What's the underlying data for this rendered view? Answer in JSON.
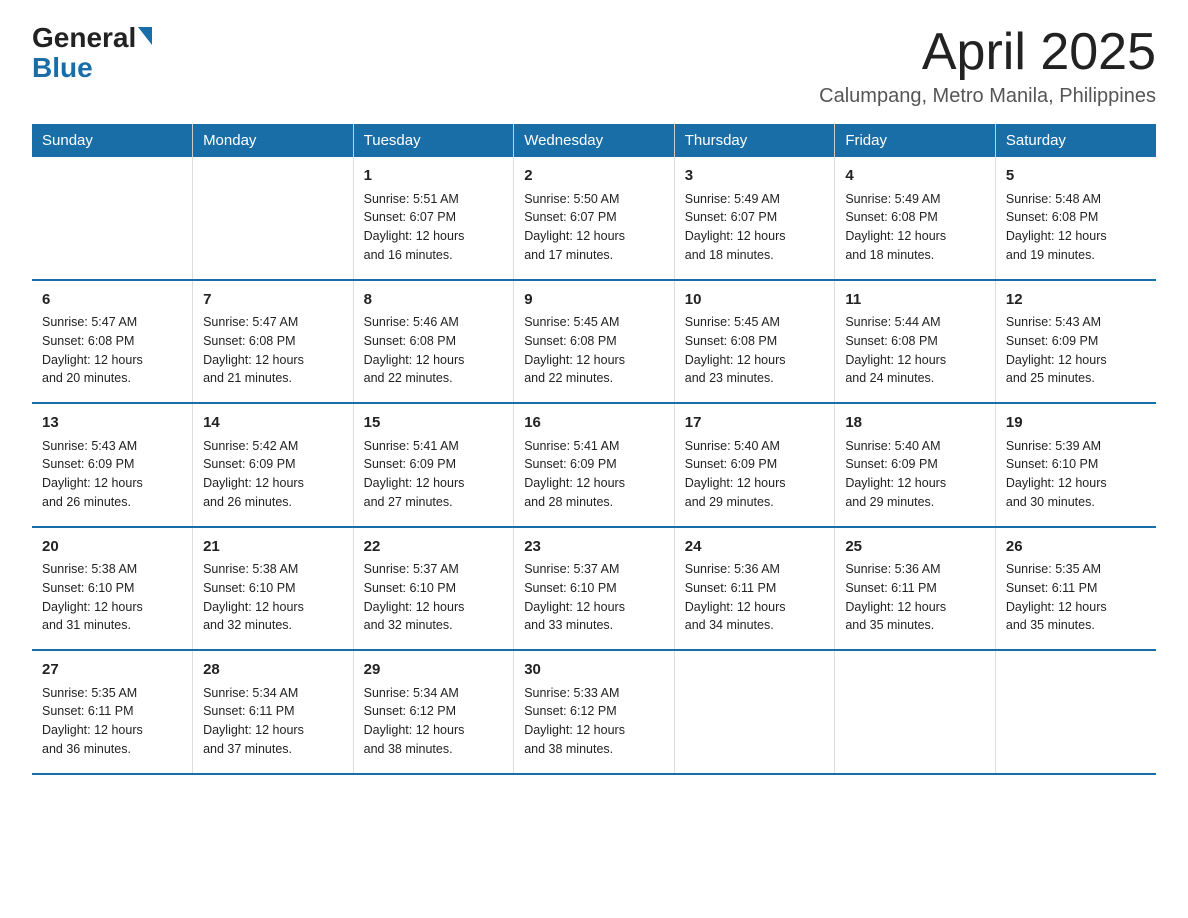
{
  "logo": {
    "general": "General",
    "blue": "Blue"
  },
  "title": "April 2025",
  "subtitle": "Calumpang, Metro Manila, Philippines",
  "header": {
    "days": [
      "Sunday",
      "Monday",
      "Tuesday",
      "Wednesday",
      "Thursday",
      "Friday",
      "Saturday"
    ]
  },
  "weeks": [
    [
      {
        "day": "",
        "info": ""
      },
      {
        "day": "",
        "info": ""
      },
      {
        "day": "1",
        "info": "Sunrise: 5:51 AM\nSunset: 6:07 PM\nDaylight: 12 hours\nand 16 minutes."
      },
      {
        "day": "2",
        "info": "Sunrise: 5:50 AM\nSunset: 6:07 PM\nDaylight: 12 hours\nand 17 minutes."
      },
      {
        "day": "3",
        "info": "Sunrise: 5:49 AM\nSunset: 6:07 PM\nDaylight: 12 hours\nand 18 minutes."
      },
      {
        "day": "4",
        "info": "Sunrise: 5:49 AM\nSunset: 6:08 PM\nDaylight: 12 hours\nand 18 minutes."
      },
      {
        "day": "5",
        "info": "Sunrise: 5:48 AM\nSunset: 6:08 PM\nDaylight: 12 hours\nand 19 minutes."
      }
    ],
    [
      {
        "day": "6",
        "info": "Sunrise: 5:47 AM\nSunset: 6:08 PM\nDaylight: 12 hours\nand 20 minutes."
      },
      {
        "day": "7",
        "info": "Sunrise: 5:47 AM\nSunset: 6:08 PM\nDaylight: 12 hours\nand 21 minutes."
      },
      {
        "day": "8",
        "info": "Sunrise: 5:46 AM\nSunset: 6:08 PM\nDaylight: 12 hours\nand 22 minutes."
      },
      {
        "day": "9",
        "info": "Sunrise: 5:45 AM\nSunset: 6:08 PM\nDaylight: 12 hours\nand 22 minutes."
      },
      {
        "day": "10",
        "info": "Sunrise: 5:45 AM\nSunset: 6:08 PM\nDaylight: 12 hours\nand 23 minutes."
      },
      {
        "day": "11",
        "info": "Sunrise: 5:44 AM\nSunset: 6:08 PM\nDaylight: 12 hours\nand 24 minutes."
      },
      {
        "day": "12",
        "info": "Sunrise: 5:43 AM\nSunset: 6:09 PM\nDaylight: 12 hours\nand 25 minutes."
      }
    ],
    [
      {
        "day": "13",
        "info": "Sunrise: 5:43 AM\nSunset: 6:09 PM\nDaylight: 12 hours\nand 26 minutes."
      },
      {
        "day": "14",
        "info": "Sunrise: 5:42 AM\nSunset: 6:09 PM\nDaylight: 12 hours\nand 26 minutes."
      },
      {
        "day": "15",
        "info": "Sunrise: 5:41 AM\nSunset: 6:09 PM\nDaylight: 12 hours\nand 27 minutes."
      },
      {
        "day": "16",
        "info": "Sunrise: 5:41 AM\nSunset: 6:09 PM\nDaylight: 12 hours\nand 28 minutes."
      },
      {
        "day": "17",
        "info": "Sunrise: 5:40 AM\nSunset: 6:09 PM\nDaylight: 12 hours\nand 29 minutes."
      },
      {
        "day": "18",
        "info": "Sunrise: 5:40 AM\nSunset: 6:09 PM\nDaylight: 12 hours\nand 29 minutes."
      },
      {
        "day": "19",
        "info": "Sunrise: 5:39 AM\nSunset: 6:10 PM\nDaylight: 12 hours\nand 30 minutes."
      }
    ],
    [
      {
        "day": "20",
        "info": "Sunrise: 5:38 AM\nSunset: 6:10 PM\nDaylight: 12 hours\nand 31 minutes."
      },
      {
        "day": "21",
        "info": "Sunrise: 5:38 AM\nSunset: 6:10 PM\nDaylight: 12 hours\nand 32 minutes."
      },
      {
        "day": "22",
        "info": "Sunrise: 5:37 AM\nSunset: 6:10 PM\nDaylight: 12 hours\nand 32 minutes."
      },
      {
        "day": "23",
        "info": "Sunrise: 5:37 AM\nSunset: 6:10 PM\nDaylight: 12 hours\nand 33 minutes."
      },
      {
        "day": "24",
        "info": "Sunrise: 5:36 AM\nSunset: 6:11 PM\nDaylight: 12 hours\nand 34 minutes."
      },
      {
        "day": "25",
        "info": "Sunrise: 5:36 AM\nSunset: 6:11 PM\nDaylight: 12 hours\nand 35 minutes."
      },
      {
        "day": "26",
        "info": "Sunrise: 5:35 AM\nSunset: 6:11 PM\nDaylight: 12 hours\nand 35 minutes."
      }
    ],
    [
      {
        "day": "27",
        "info": "Sunrise: 5:35 AM\nSunset: 6:11 PM\nDaylight: 12 hours\nand 36 minutes."
      },
      {
        "day": "28",
        "info": "Sunrise: 5:34 AM\nSunset: 6:11 PM\nDaylight: 12 hours\nand 37 minutes."
      },
      {
        "day": "29",
        "info": "Sunrise: 5:34 AM\nSunset: 6:12 PM\nDaylight: 12 hours\nand 38 minutes."
      },
      {
        "day": "30",
        "info": "Sunrise: 5:33 AM\nSunset: 6:12 PM\nDaylight: 12 hours\nand 38 minutes."
      },
      {
        "day": "",
        "info": ""
      },
      {
        "day": "",
        "info": ""
      },
      {
        "day": "",
        "info": ""
      }
    ]
  ]
}
